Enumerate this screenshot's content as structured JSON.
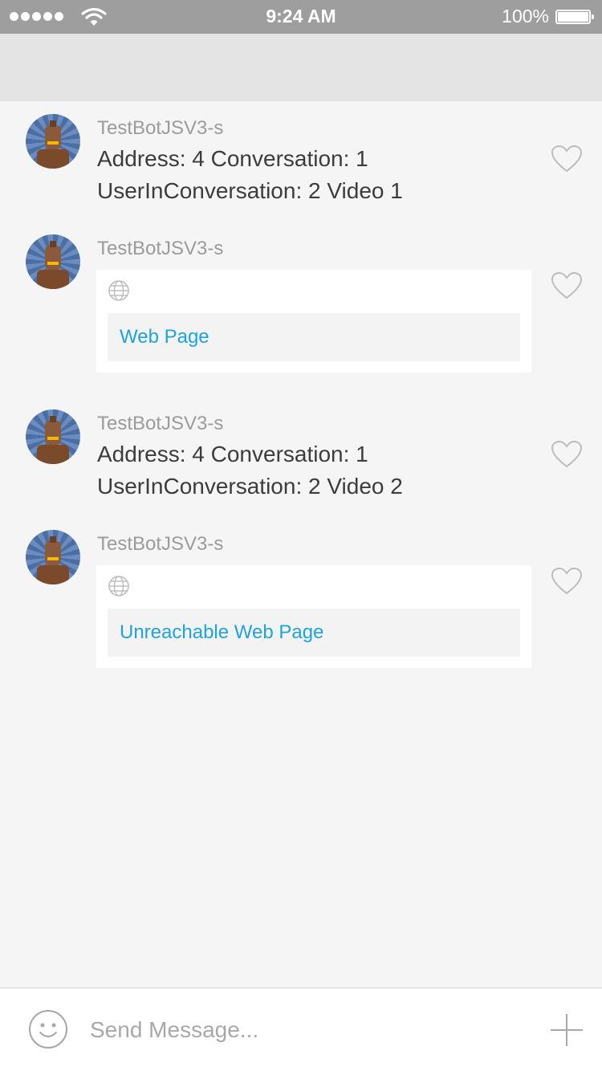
{
  "status_bar": {
    "time": "9:24 AM",
    "battery": "100%"
  },
  "messages": [
    {
      "type": "text",
      "sender": "TestBotJSV3-s",
      "lines": [
        "Address: 4 Conversation: 1",
        "UserInConversation: 2 Video 1"
      ]
    },
    {
      "type": "card",
      "sender": "TestBotJSV3-s",
      "link": "Web Page"
    },
    {
      "type": "text",
      "sender": "TestBotJSV3-s",
      "lines": [
        "Address: 4 Conversation: 1",
        "UserInConversation: 2 Video 2"
      ]
    },
    {
      "type": "card",
      "sender": "TestBotJSV3-s",
      "link": "Unreachable Web Page"
    }
  ],
  "input": {
    "placeholder": "Send Message..."
  },
  "icons": {
    "avatar": "bot-avatar-icon",
    "like": "heart-icon",
    "link": "globe-icon",
    "emoji": "smiley-icon",
    "add": "plus-icon"
  },
  "colors": {
    "link": "#1fa3e0",
    "status_bar": "#9e9e9e",
    "header": "#e4e4e4"
  }
}
